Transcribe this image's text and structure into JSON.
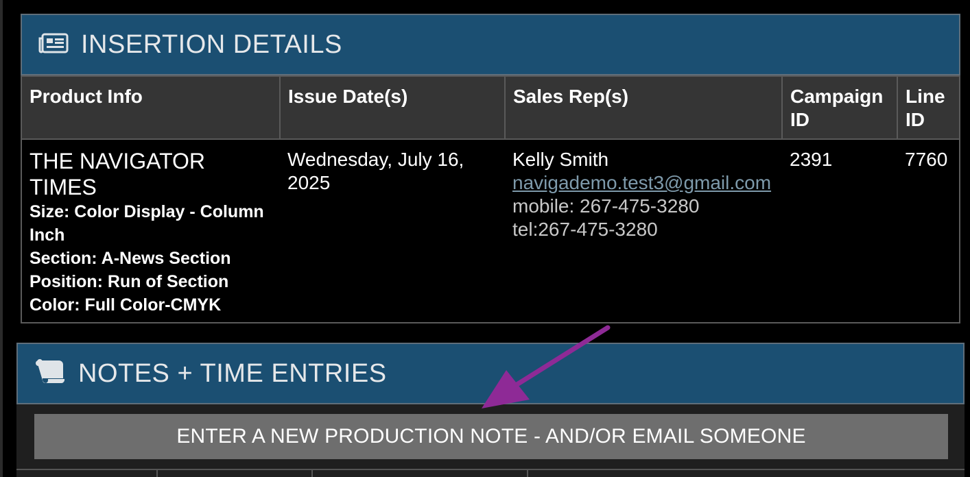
{
  "insertion": {
    "title": "INSERTION DETAILS",
    "icon": "newspaper-icon",
    "columns": [
      "Product Info",
      "Issue Date(s)",
      "Sales Rep(s)",
      "Campaign ID",
      "Line ID"
    ],
    "row": {
      "product_name": "THE NAVIGATOR TIMES",
      "size": "Size: Color Display - Column Inch",
      "section": "Section: A-News Section",
      "position": "Position: Run of Section",
      "color": "Color: Full Color-CMYK",
      "issue_date": "Wednesday, July 16, 2025",
      "rep_name": "Kelly Smith",
      "rep_email": "navigademo.test3@gmail.com",
      "rep_mobile": "mobile: 267-475-3280",
      "rep_tel": "tel:267-475-3280",
      "campaign_id": "2391",
      "line_id": "7760"
    }
  },
  "notes": {
    "title": "NOTES + TIME ENTRIES",
    "icon": "scroll-icon",
    "new_note_label": "ENTER A NEW PRODUCTION NOTE - AND/OR EMAIL SOMEONE"
  },
  "colors": {
    "header_blue": "#1b4f72",
    "button_gray": "#6e6e6e",
    "link": "#7e9aab",
    "annotation_arrow": "#8e2a96"
  }
}
